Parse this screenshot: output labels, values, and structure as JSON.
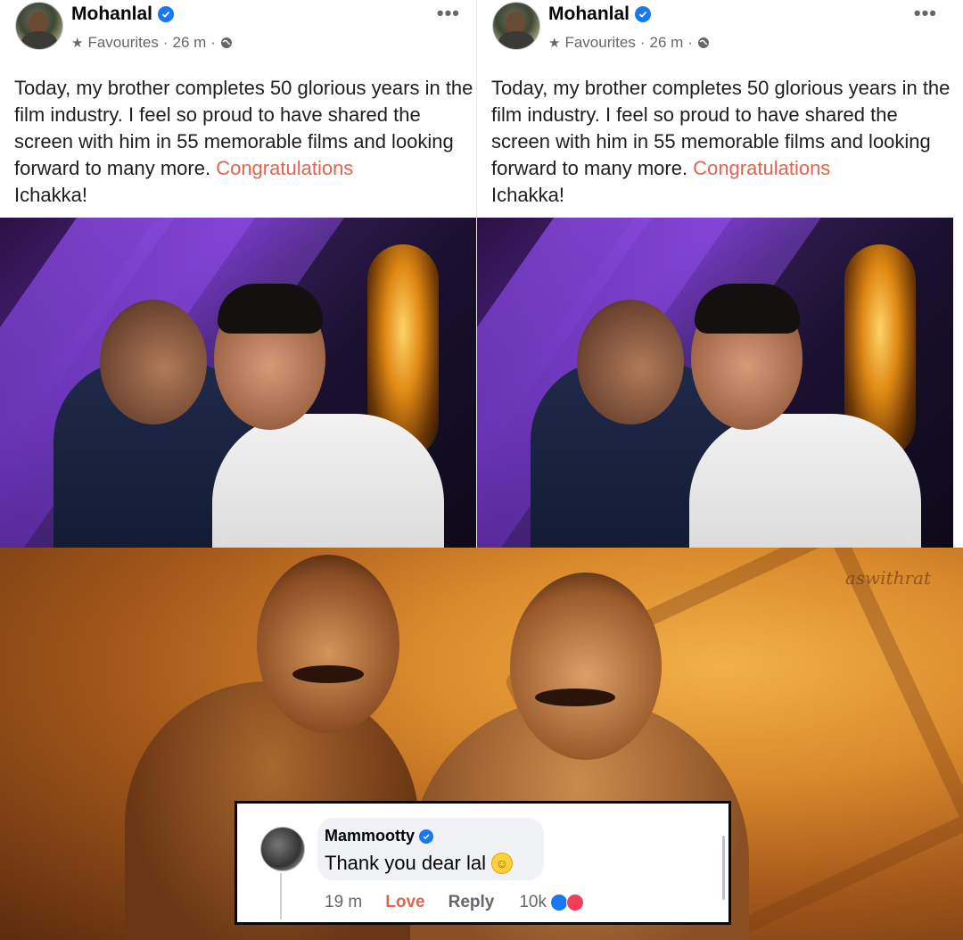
{
  "posts": [
    {
      "author": "Mohanlal",
      "audience": "Favourites",
      "time": "26 m",
      "text": "Today, my brother completes 50 glorious years in the film industry. I feel so proud to have shared the screen with him in 55 memorable films and looking forward to many more.",
      "tag": "Congratulations",
      "tail": "Ichakka!"
    },
    {
      "author": "Mohanlal",
      "audience": "Favourites",
      "time": "26 m",
      "text": "Today, my brother completes 50 glorious years in the film industry. I feel so proud to have shared the screen with him in 55 memorable films and looking forward to many more.",
      "tag": "Congratulations",
      "tail": "Ichakka!"
    }
  ],
  "banner": {
    "watermark": "aswithrat"
  },
  "comment": {
    "author": "Mammootty",
    "text": "Thank you dear lal",
    "time": "19 m",
    "love_label": "Love",
    "reply_label": "Reply",
    "reaction_count": "10k"
  },
  "colors": {
    "accent": "#1877f2",
    "tag": "#e2634e"
  }
}
